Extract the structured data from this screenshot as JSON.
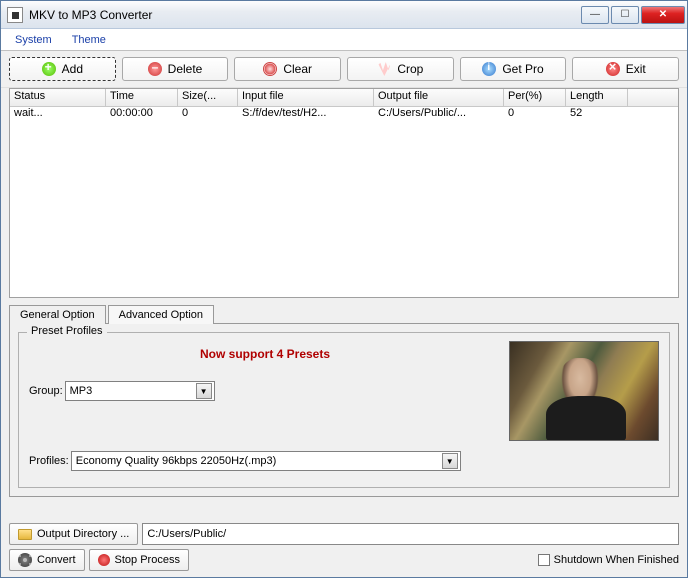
{
  "window": {
    "title": "MKV to MP3 Converter"
  },
  "menu": {
    "system": "System",
    "theme": "Theme"
  },
  "toolbar": {
    "add": "Add",
    "delete": "Delete",
    "clear": "Clear",
    "crop": "Crop",
    "getpro": "Get Pro",
    "exit": "Exit"
  },
  "grid": {
    "headers": {
      "status": "Status",
      "time": "Time",
      "size": "Size(...",
      "input": "Input file",
      "output": "Output file",
      "per": "Per(%)",
      "length": "Length"
    },
    "rows": [
      {
        "status": "wait...",
        "time": "00:00:00",
        "size": "0",
        "input": "S:/f/dev/test/H2...",
        "output": "C:/Users/Public/...",
        "per": "0",
        "length": "52"
      }
    ]
  },
  "tabs": {
    "general": "General Option",
    "advanced": "Advanced Option"
  },
  "presets": {
    "legend": "Preset Profiles",
    "message": "Now support 4 Presets",
    "group_label": "Group:",
    "group_value": "MP3",
    "profiles_label": "Profiles:",
    "profiles_value": "Economy Quality 96kbps 22050Hz(.mp3)"
  },
  "output": {
    "button": "Output Directory ...",
    "path": "C:/Users/Public/"
  },
  "actions": {
    "convert": "Convert",
    "stop": "Stop Process",
    "shutdown": "Shutdown When Finished"
  }
}
